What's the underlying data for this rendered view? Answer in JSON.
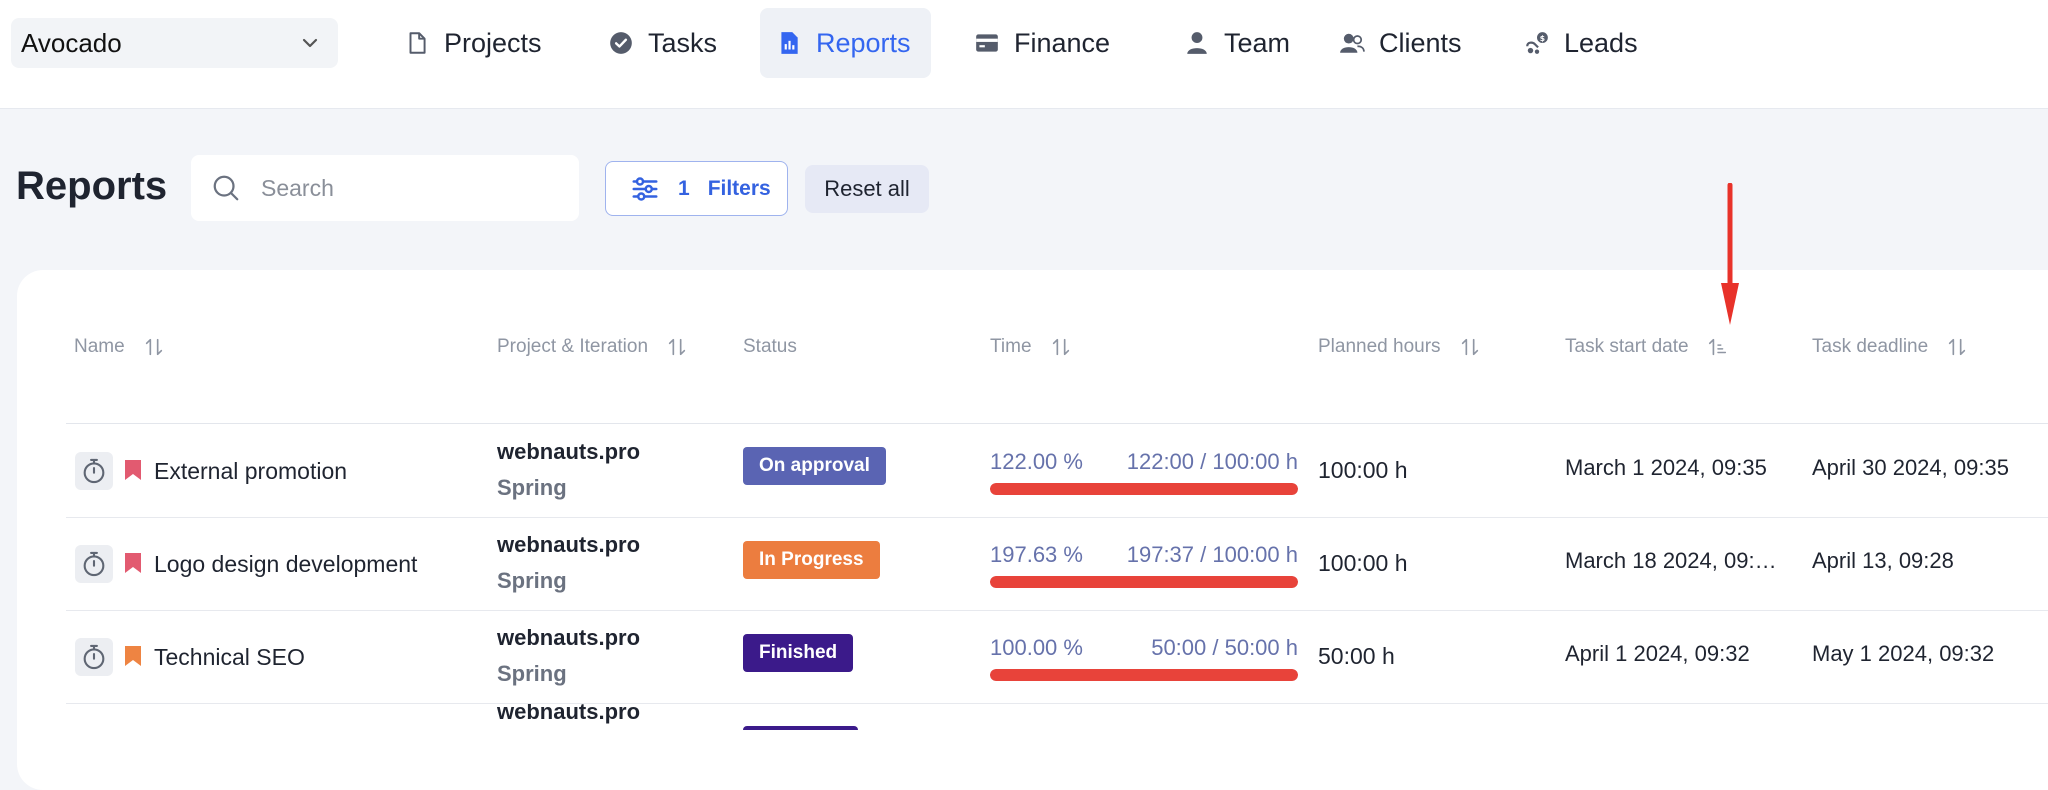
{
  "topbar": {
    "workspace": "Avocado",
    "nav": [
      {
        "label": "Projects",
        "icon": "file-icon"
      },
      {
        "label": "Tasks",
        "icon": "check-circle-icon"
      },
      {
        "label": "Reports",
        "icon": "report-icon",
        "active": true
      },
      {
        "label": "Finance",
        "icon": "wallet-icon"
      },
      {
        "label": "Team",
        "icon": "person-icon"
      },
      {
        "label": "Clients",
        "icon": "clients-icon"
      },
      {
        "label": "Leads",
        "icon": "leads-icon"
      }
    ]
  },
  "page": {
    "title": "Reports",
    "search_placeholder": "Search",
    "filters_count": "1",
    "filters_label": "Filters",
    "reset_label": "Reset all"
  },
  "table": {
    "columns": [
      "Name",
      "Project & Iteration",
      "Status",
      "Time",
      "Planned hours",
      "Task start date",
      "Task deadline"
    ],
    "rows": [
      {
        "name": "External promotion",
        "flag_color": "#e25a70",
        "project": "webnauts.pro",
        "iteration": "Spring",
        "status": "On approval",
        "status_color": "#5a64b3",
        "time_percent": "122.00 %",
        "time_ratio": "122:00 / 100:00 h",
        "progress": 1.0,
        "planned": "100:00 h",
        "start": "March 1 2024, 09:35",
        "deadline": "April 30 2024, 09:35"
      },
      {
        "name": "Logo design development",
        "flag_color": "#e25a70",
        "project": "webnauts.pro",
        "iteration": "Spring",
        "status": "In Progress",
        "status_color": "#ec7d3f",
        "time_percent": "197.63 %",
        "time_ratio": "197:37 / 100:00 h",
        "progress": 1.0,
        "planned": "100:00 h",
        "start": "March 18 2024, 09:…",
        "deadline": "April 13, 09:28"
      },
      {
        "name": "Technical SEO",
        "flag_color": "#ee8442",
        "project": "webnauts.pro",
        "iteration": "Spring",
        "status": "Finished",
        "status_color": "#3b1a8a",
        "time_percent": "100.00 %",
        "time_ratio": "50:00 / 50:00 h",
        "progress": 1.0,
        "planned": "50:00 h",
        "start": "April 1 2024, 09:32",
        "deadline": "May 1 2024, 09:32"
      }
    ],
    "partial_row": {
      "project": "webnauts.pro",
      "status_color": "#3b1a8a"
    }
  },
  "colors": {
    "accent": "#3466f0",
    "annotation_arrow": "#e8322a",
    "progress_fill": "#e8433a"
  }
}
